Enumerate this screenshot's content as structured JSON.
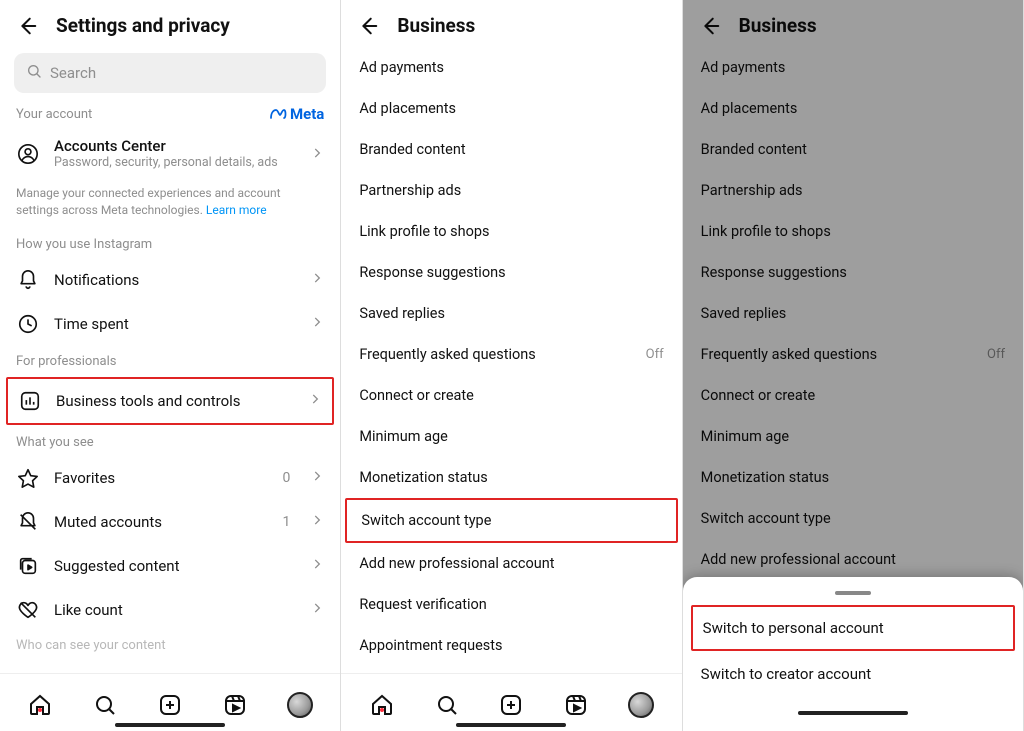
{
  "panel1": {
    "title": "Settings and privacy",
    "search_placeholder": "Search",
    "your_account_label": "Your account",
    "meta_label": "Meta",
    "accounts_center": {
      "title": "Accounts Center",
      "subtitle": "Password, security, personal details, ads"
    },
    "manage_note": "Manage your connected experiences and account settings across Meta technologies. ",
    "learn_more": "Learn more",
    "how_you_use_label": "How you use Instagram",
    "notifications": "Notifications",
    "time_spent": "Time spent",
    "for_professionals_label": "For professionals",
    "business_tools": "Business tools and controls",
    "what_you_see_label": "What you see",
    "favorites": {
      "label": "Favorites",
      "count": "0"
    },
    "muted": {
      "label": "Muted accounts",
      "count": "1"
    },
    "suggested": "Suggested content",
    "like_count": "Like count",
    "cutoff_label": "Who can see your content"
  },
  "panel2": {
    "title": "Business",
    "items": [
      {
        "label": "Ad payments"
      },
      {
        "label": "Ad placements"
      },
      {
        "label": "Branded content"
      },
      {
        "label": "Partnership ads"
      },
      {
        "label": "Link profile to shops"
      },
      {
        "label": "Response suggestions"
      },
      {
        "label": "Saved replies"
      },
      {
        "label": "Frequently asked questions",
        "trail": "Off"
      },
      {
        "label": "Connect or create"
      },
      {
        "label": "Minimum age"
      },
      {
        "label": "Monetization status"
      },
      {
        "label": "Switch account type",
        "highlight": true
      },
      {
        "label": "Add new professional account"
      },
      {
        "label": "Request verification"
      },
      {
        "label": "Appointment requests"
      }
    ]
  },
  "panel3": {
    "title": "Business",
    "items": [
      {
        "label": "Ad payments"
      },
      {
        "label": "Ad placements"
      },
      {
        "label": "Branded content"
      },
      {
        "label": "Partnership ads"
      },
      {
        "label": "Link profile to shops"
      },
      {
        "label": "Response suggestions"
      },
      {
        "label": "Saved replies"
      },
      {
        "label": "Frequently asked questions",
        "trail": "Off"
      },
      {
        "label": "Connect or create"
      },
      {
        "label": "Minimum age"
      },
      {
        "label": "Monetization status"
      },
      {
        "label": "Switch account type"
      },
      {
        "label": "Add new professional account"
      }
    ],
    "sheet": {
      "switch_personal": "Switch to personal account",
      "switch_creator": "Switch to creator account"
    }
  }
}
